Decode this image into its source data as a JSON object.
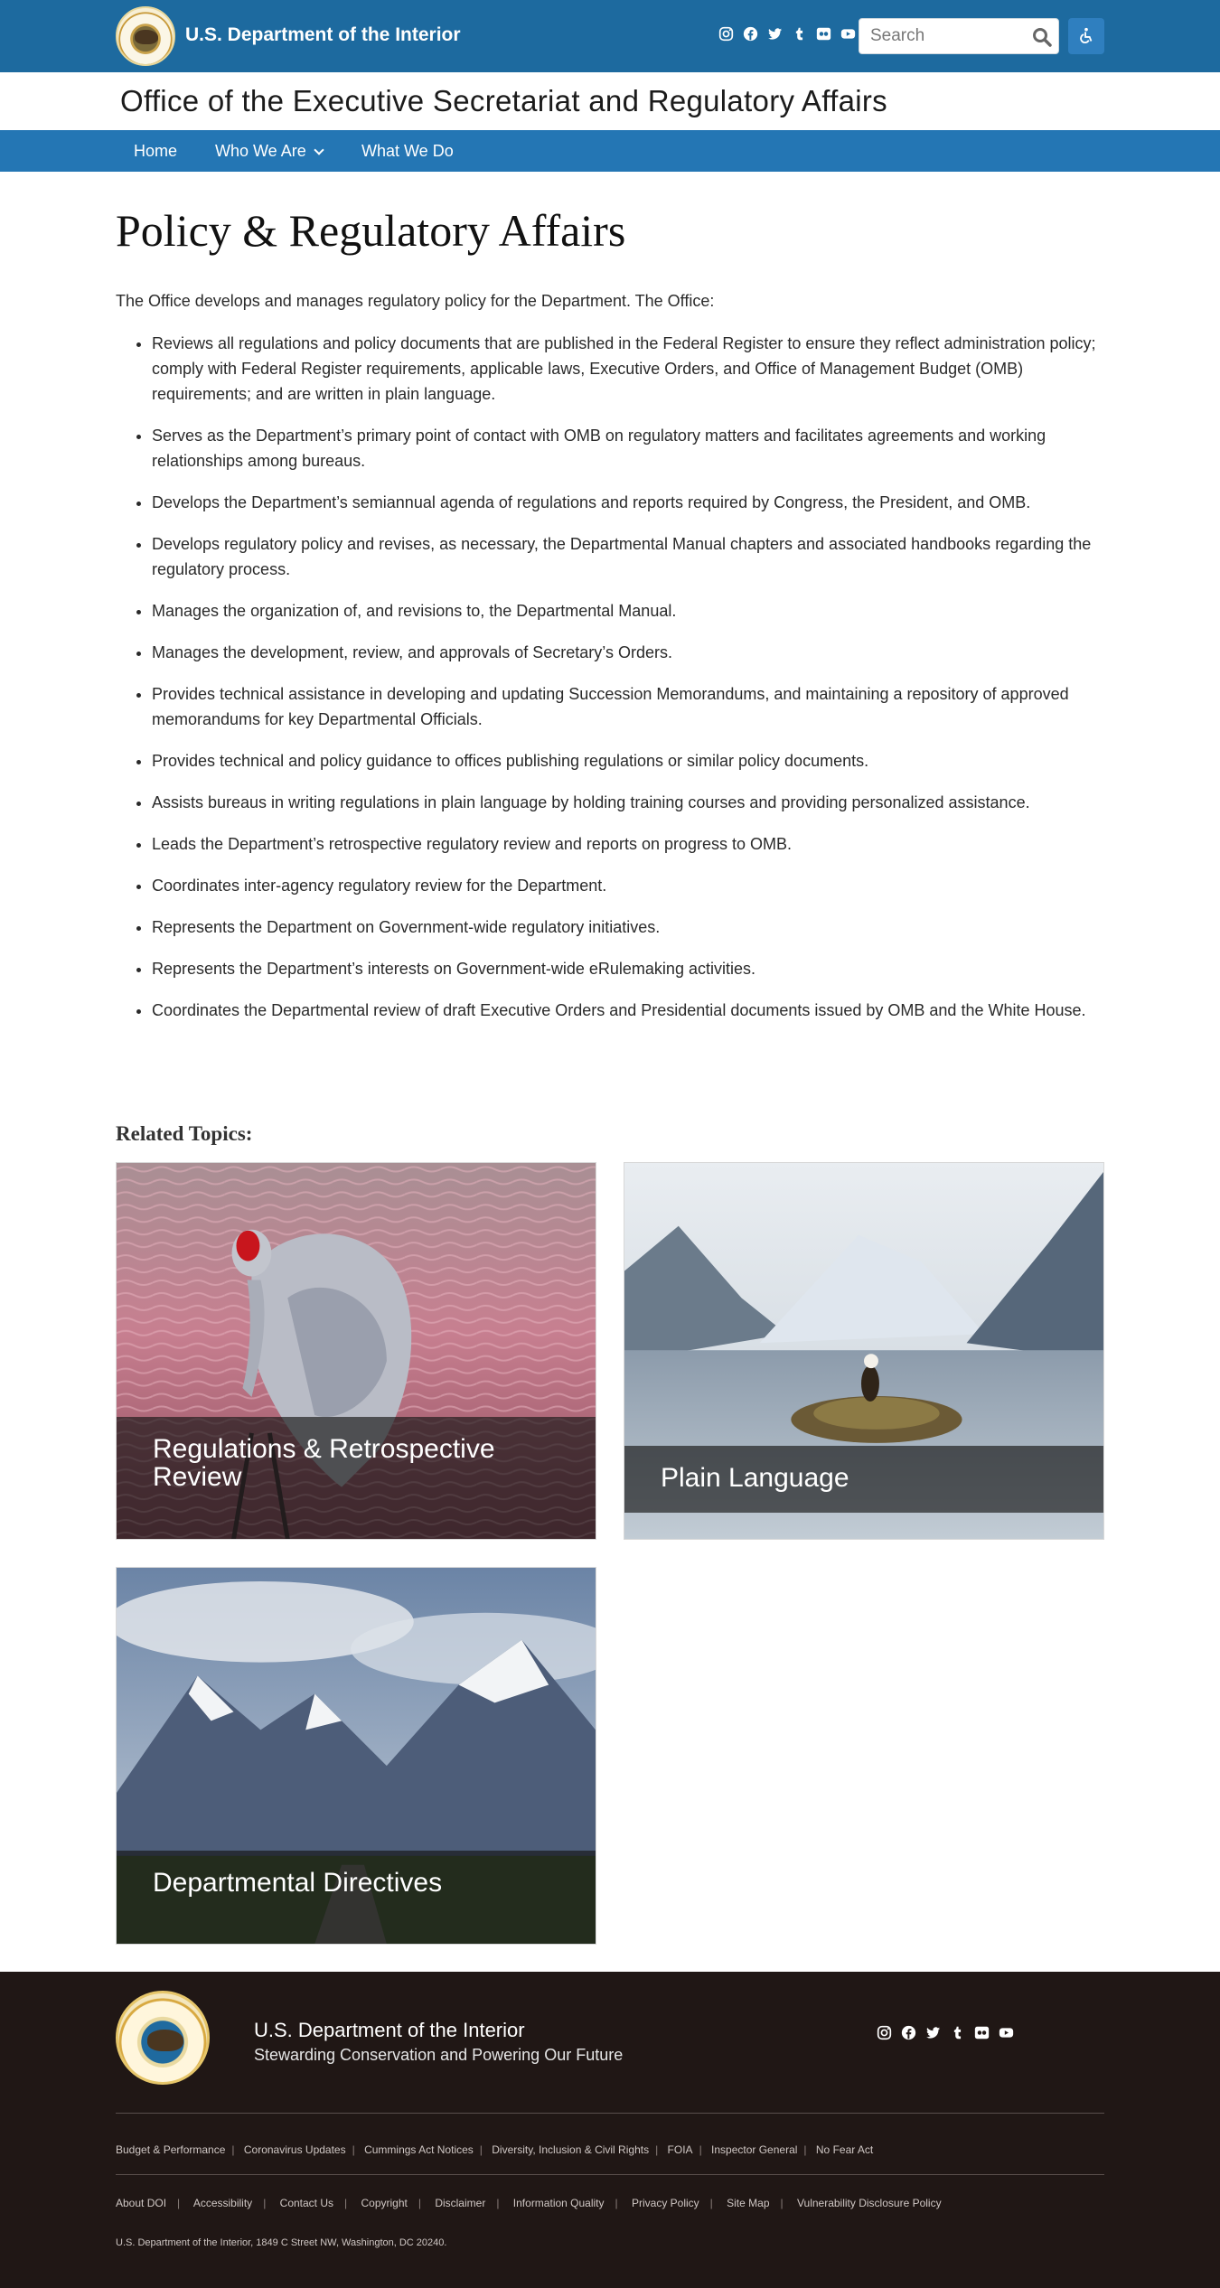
{
  "header": {
    "site_name": "U.S. Department of the Interior",
    "social_icons": [
      "instagram-icon",
      "facebook-icon",
      "twitter-icon",
      "tumblr-icon",
      "flickr-icon",
      "youtube-icon"
    ],
    "search_placeholder": "Search",
    "office_title": "Office of the Executive Secretariat and Regulatory Affairs",
    "colors": {
      "topbar": "#1d6a9f",
      "navbar": "#2476b4",
      "footer": "#201715"
    }
  },
  "nav": {
    "items": [
      {
        "label": "Home"
      },
      {
        "label": "Who We Are",
        "has_dropdown": true
      },
      {
        "label": "What We Do"
      }
    ]
  },
  "main": {
    "title": "Policy & Regulatory Affairs",
    "intro": "The Office develops and manages regulatory policy for the Department. The Office:",
    "duties": [
      "Reviews all regulations and policy documents that are published in the Federal Register to ensure they reflect administration policy; comply with Federal Register requirements, applicable laws, Executive Orders, and Office of Management Budget (OMB) requirements; and are written in plain language.",
      "Serves as the Department’s primary point of contact with OMB on regulatory matters and facilitates agreements and working relationships among bureaus.",
      "Develops the Department’s semiannual agenda of regulations and reports required by Congress, the President, and OMB.",
      "Develops regulatory policy and revises, as necessary, the Departmental Manual chapters and associated handbooks regarding the regulatory process.",
      "Manages the organization of, and revisions to, the Departmental Manual.",
      "Manages the development, review, and approvals of Secretary’s Orders.",
      "Provides technical assistance in developing and updating Succession Memorandums, and maintaining a repository of approved memorandums for key Departmental Officials.",
      "Provides technical and policy guidance to offices publishing regulations or similar policy documents.",
      "Assists bureaus in writing regulations in plain language by holding training courses and providing personalized assistance.",
      "Leads the Department’s retrospective regulatory review and reports on progress to OMB.",
      "Coordinates inter-agency regulatory review for the Department.",
      "Represents the Department on Government-wide regulatory initiatives.",
      "Represents the Department’s interests on Government-wide eRulemaking activities.",
      "Coordinates the Departmental review of draft Executive Orders and Presidential documents issued by OMB and the White House."
    ]
  },
  "related": {
    "title": "Related Topics:",
    "cards": [
      {
        "title": "Regulations & Retrospective Review"
      },
      {
        "title": "Plain Language"
      },
      {
        "title": "Departmental Directives"
      }
    ]
  },
  "footer": {
    "name": "U.S. Department of the Interior",
    "tagline": "Stewarding Conservation and Powering Our Future",
    "links_row1": [
      "Budget & Performance",
      "Coronavirus Updates",
      "Cummings Act Notices",
      "Diversity, Inclusion & Civil Rights",
      "FOIA",
      "Inspector General",
      "No Fear Act"
    ],
    "links_row2": [
      "About DOI",
      "Accessibility",
      "Contact Us",
      "Copyright",
      "Disclaimer",
      "Information Quality",
      "Privacy Policy",
      "Site Map",
      "Vulnerability Disclosure Policy"
    ],
    "address": "U.S. Department of the Interior, 1849 C Street NW, Washington, DC 20240."
  }
}
